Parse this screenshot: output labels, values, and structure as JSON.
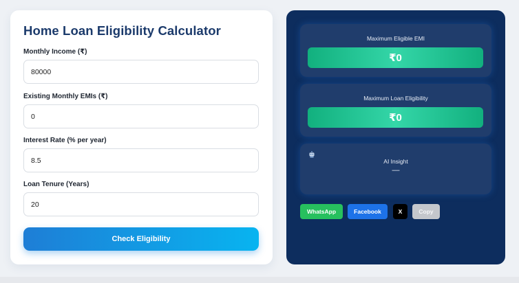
{
  "form": {
    "title": "Home Loan Eligibility Calculator",
    "fields": [
      {
        "label": "Monthly Income (₹)",
        "value": "80000"
      },
      {
        "label": "Existing Monthly EMIs (₹)",
        "value": "0"
      },
      {
        "label": "Interest Rate (% per year)",
        "value": "8.5"
      },
      {
        "label": "Loan Tenure (Years)",
        "value": "20"
      }
    ],
    "submit_label": "Check Eligibility"
  },
  "results": {
    "emi": {
      "label": "Maximum Eligible EMI",
      "value": "₹0"
    },
    "loan": {
      "label": "Maximum Loan Eligibility",
      "value": "₹0"
    },
    "insight": {
      "icon": "robot-icon",
      "title": "AI Insight",
      "text": "—"
    }
  },
  "share": {
    "whatsapp": "WhatsApp",
    "facebook": "Facebook",
    "x": "X",
    "copy": "Copy"
  },
  "colors": {
    "title": "#1b3a6b",
    "panel": "#0d2d5e",
    "result_box": "#203d6c",
    "value_green": "#12b07e",
    "button_blue": "#1e7ed6",
    "whatsapp": "#27c05e",
    "facebook": "#1d72e8"
  }
}
